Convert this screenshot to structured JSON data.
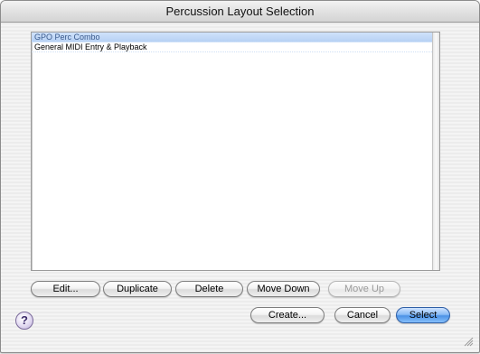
{
  "window": {
    "title": "Percussion Layout Selection"
  },
  "list": {
    "items": [
      {
        "label": "GPO Perc Combo",
        "selected": true
      },
      {
        "label": "General MIDI Entry & Playback",
        "selected": false
      }
    ]
  },
  "row_buttons": {
    "edit": "Edit...",
    "duplicate": "Duplicate",
    "delete": "Delete",
    "move_down": "Move Down",
    "move_up": "Move Up"
  },
  "bottom_buttons": {
    "create": "Create...",
    "cancel": "Cancel",
    "select": "Select"
  },
  "help": {
    "glyph": "?"
  },
  "icons": {
    "help": "help-icon",
    "resize": "resize-grip-icon"
  },
  "colors": {
    "default_button": "#4c92e6",
    "selection": "#b7d1f4"
  }
}
